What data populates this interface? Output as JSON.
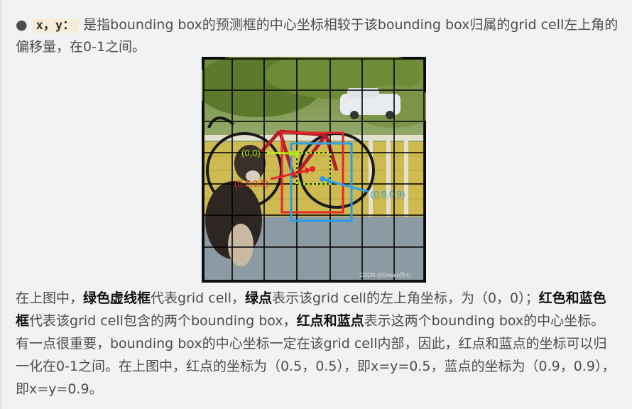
{
  "intro": {
    "bullet": "●",
    "code": "x，y：",
    "text": "是指bounding box的预测框的中心坐标相较于该bounding box归属的grid cell左上角的偏移量，在0-1之间。"
  },
  "figure": {
    "label_green": "(0,0)",
    "label_red": "(0.5,0.5)",
    "label_blue": "(0.9,0.9)",
    "watermark": "CSDN @Dream伪心"
  },
  "body": {
    "t1": "在上图中，",
    "b1": "绿色虚线框",
    "t2": "代表grid cell，",
    "b2": "绿点",
    "t3": "表示该grid cell的左上角坐标，为（0，0）；",
    "b3": "红色和蓝色框",
    "t4": "代表该grid cell包含的两个bounding box，",
    "b4": "红点和蓝点",
    "t5": "表示这两个bounding box的中心坐标。有一点很重要，bounding box的中心坐标一定在该grid cell内部，因此，红点和蓝点的坐标可以归一化在0-1之间。在上图中，红点的坐标为（0.5，0.5），即x=y=0.5，蓝点的坐标为（0.9，0.9），即x=y=0.9。"
  },
  "colors": {
    "green": "#b6e61a",
    "red": "#e5252a",
    "blue": "#2a9ee6"
  }
}
